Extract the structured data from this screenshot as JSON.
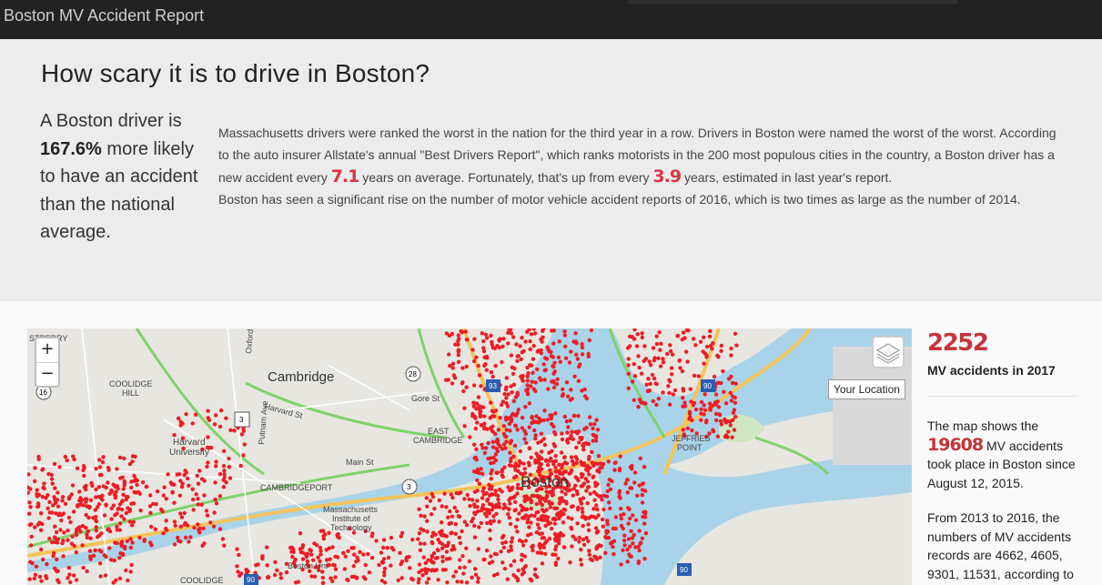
{
  "navbar": {
    "brand": "Boston MV Accident Report"
  },
  "hero": {
    "title": "How scary it is to drive in Boston?",
    "lead": {
      "line1": "A Boston driver is",
      "percent": "167.6%",
      "after_percent": "more likely to have an accident than the national average."
    },
    "paragraph": {
      "line1": "Massachusetts drivers were ranked the worst in the nation for the third year in a row. Drivers in Boston were named the worst of the worst.",
      "line2": "According to the auto insurer Allstate's annual \"Best Drivers Report\", which ranks motorists in the 200 most populous cities in the country, a Boston driver has a new accident every",
      "value1": "7.1",
      "mid": "years on average. Fortunately, that's up from every",
      "value2": "3.9",
      "tail": "years, estimated in last year's report.",
      "line4": "Boston has seen a significant rise on the number of motor vehicle accident reports of 2016, which is two times as large as the number of 2014."
    }
  },
  "map": {
    "zoom_in": "+",
    "zoom_out": "−",
    "tooltip": "Your Location",
    "labels": {
      "cambridge": "Cambridge",
      "coolidge_hill": "COOLIDGE\nHILL",
      "harvard": "Harvard\nUniversity",
      "cambridgeport": "CAMBRIDGEPORT",
      "mit": "Massachusetts\nInstitute of\nTechnology",
      "east_cambridge": "EAST\nCAMBRIDGE",
      "boston": "Boston",
      "jeffries_point": "JEFFRIES\nPOINT",
      "main_st": "Main St",
      "harvard_st": "Harvard St",
      "gore_st": "Gore St",
      "putnam_ave": "Putnam Ave",
      "coolidge": "COOLIDGE",
      "boston_uni": "Boston Uni",
      "oxford": "Oxford",
      "perry": "STPERRY"
    },
    "shields": [
      "16",
      "3",
      "28",
      "3",
      "93",
      "90",
      "90",
      "90"
    ],
    "colors": {
      "water": "#a9d3e9",
      "land": "#e8e6e1",
      "park": "#cfe6c2",
      "highway": "#f5c45a",
      "traffic_green": "#7ed26a",
      "accident_dot": "#ee1c25"
    }
  },
  "sidebar": {
    "stat_count": "2252",
    "stat_label": "MV accidents in 2017",
    "p1_pre": "The map shows the",
    "p1_value": "19608",
    "p1_post": "MV accidents took place in Boston since August 12, 2015.",
    "p2": "From 2013 to 2016, the numbers of MV accidents records are 4662, 4605, 9301, 11531, according to"
  }
}
